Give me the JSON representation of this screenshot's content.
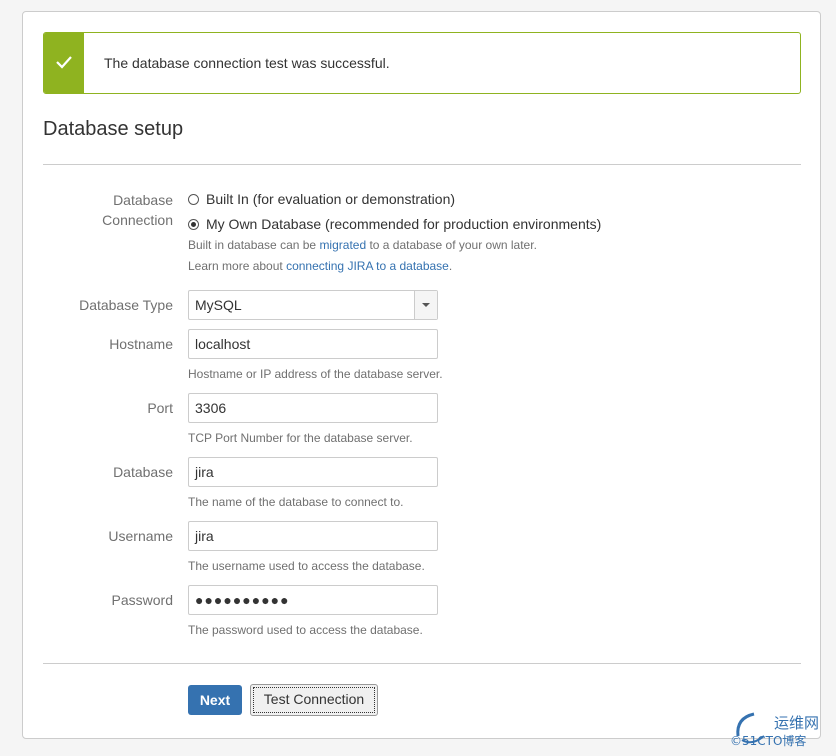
{
  "success": {
    "message": "The database connection test was successful."
  },
  "heading": "Database setup",
  "connection": {
    "label_line1": "Database",
    "label_line2": "Connection",
    "options": [
      {
        "label": "Built In (for evaluation or demonstration)",
        "checked": false
      },
      {
        "label": "My Own Database (recommended for production environments)",
        "checked": true
      }
    ],
    "help1_pre": "Built in database can be ",
    "help1_link": "migrated",
    "help1_post": " to a database of your own later.",
    "help2_pre": "Learn more about ",
    "help2_link": "connecting JIRA to a database",
    "help2_post": "."
  },
  "fields": {
    "db_type": {
      "label": "Database Type",
      "value": "MySQL"
    },
    "hostname": {
      "label": "Hostname",
      "value": "localhost",
      "help": "Hostname or IP address of the database server."
    },
    "port": {
      "label": "Port",
      "value": "3306",
      "help": "TCP Port Number for the database server."
    },
    "database": {
      "label": "Database",
      "value": "jira",
      "help": "The name of the database to connect to."
    },
    "username": {
      "label": "Username",
      "value": "jira",
      "help": "The username used to access the database."
    },
    "password": {
      "label": "Password",
      "value": "●●●●●●●●●●",
      "help": "The password used to access the database."
    }
  },
  "buttons": {
    "next": "Next",
    "test": "Test Connection"
  },
  "watermark": {
    "cn": "运维网",
    "en": "©51CTO博客"
  },
  "colors": {
    "success": "#8fb320",
    "primary": "#3572b0",
    "link": "#3572b0"
  }
}
